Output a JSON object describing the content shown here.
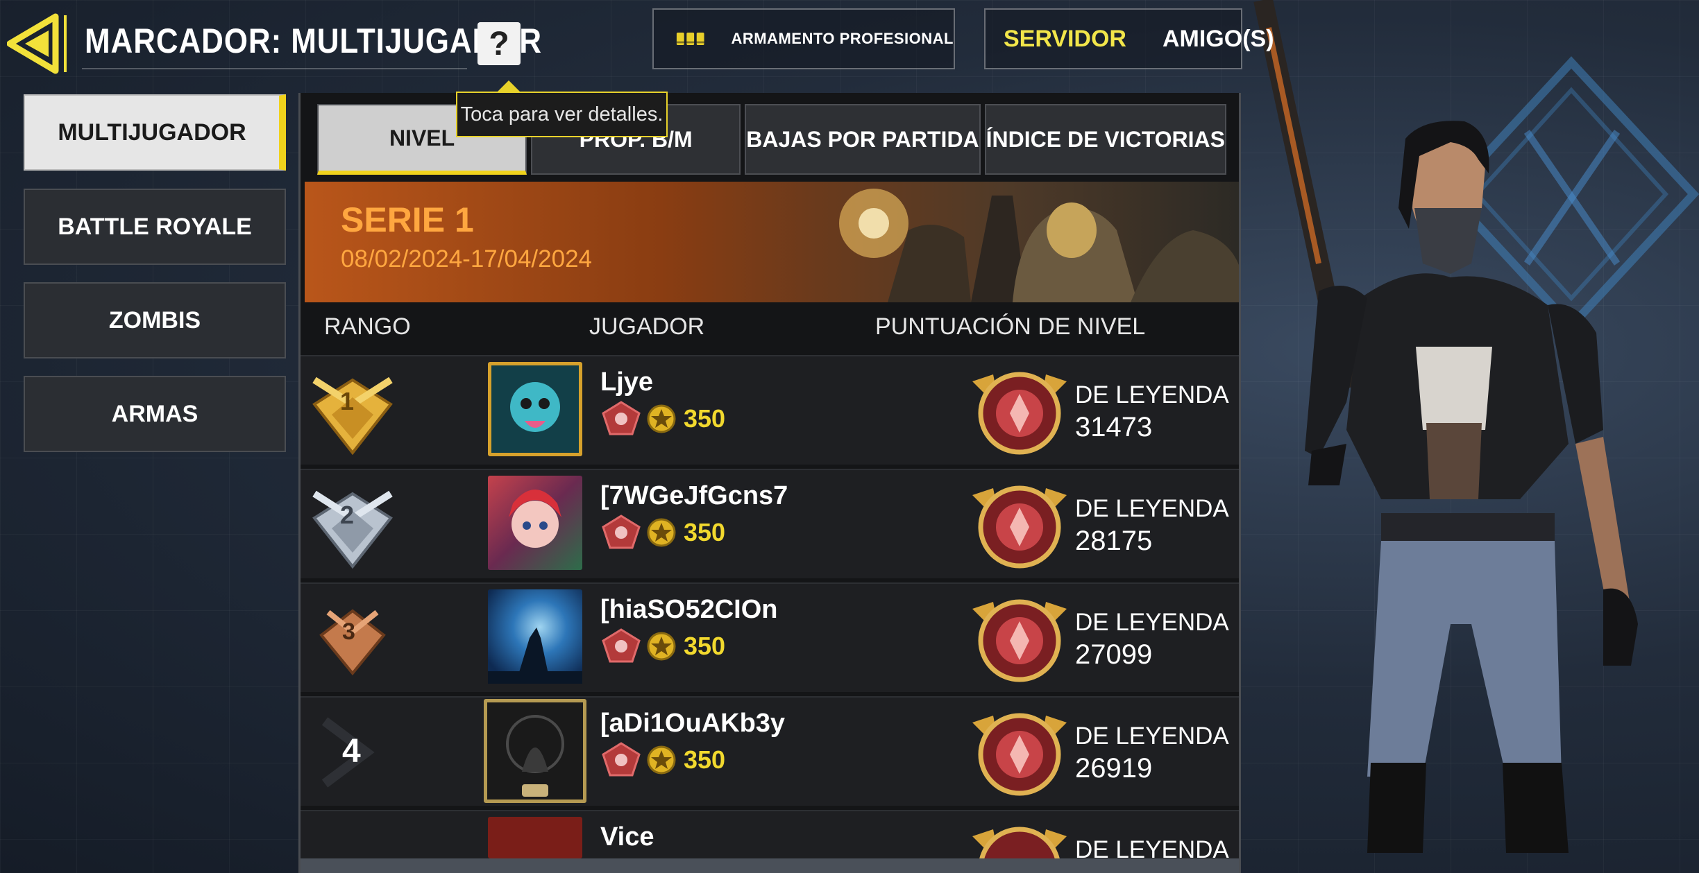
{
  "header": {
    "title": "MARCADOR: MULTIJUGADOR",
    "help_label": "?",
    "tooltip": "Toca para ver detalles.",
    "loadout_label": "ARMAMENTO PROFESIONAL",
    "scope_tabs": [
      {
        "label": "SERVIDOR",
        "active": true
      },
      {
        "label": "AMIGO(S)",
        "active": false
      }
    ]
  },
  "sidebar": {
    "modes": [
      {
        "label": "MULTIJUGADOR",
        "active": true
      },
      {
        "label": "BATTLE ROYALE",
        "active": false
      },
      {
        "label": "ZOMBIS",
        "active": false
      },
      {
        "label": "ARMAS",
        "active": false
      }
    ]
  },
  "leaderboard": {
    "categories": [
      {
        "label": "NIVEL",
        "active": true
      },
      {
        "label": "PROP. B/M",
        "active": false
      },
      {
        "label": "BAJAS POR PARTIDA",
        "active": false
      },
      {
        "label": "ÍNDICE DE VICTORIAS",
        "active": false
      }
    ],
    "season": {
      "title": "SERIE 1",
      "dates": "08/02/2024-17/04/2024"
    },
    "columns": {
      "rank": "RANGO",
      "player": "JUGADOR",
      "score": "PUNTUACIÓN DE NIVEL"
    },
    "rows": [
      {
        "rank": "1",
        "name": "Ljye",
        "points": "350",
        "tier": "DE LEYENDA",
        "score": "31473"
      },
      {
        "rank": "2",
        "name": "[7WGeJfGcns7",
        "points": "350",
        "tier": "DE LEYENDA",
        "score": "28175"
      },
      {
        "rank": "3",
        "name": "[hiaSO52CIOn",
        "points": "350",
        "tier": "DE LEYENDA",
        "score": "27099"
      },
      {
        "rank": "4",
        "name": "[aDi1OuAKb3y",
        "points": "350",
        "tier": "DE LEYENDA",
        "score": "26919"
      },
      {
        "rank": "",
        "name": "Vice",
        "points": "",
        "tier": "DE LEYENDA",
        "score": ""
      }
    ]
  },
  "colors": {
    "accent": "#f0d21c",
    "season_text": "#ffa740",
    "points": "#f2d92e",
    "gold_medal": "#e5b23c",
    "silver_medal": "#b9c3cf",
    "bronze_medal": "#c47a4c"
  }
}
